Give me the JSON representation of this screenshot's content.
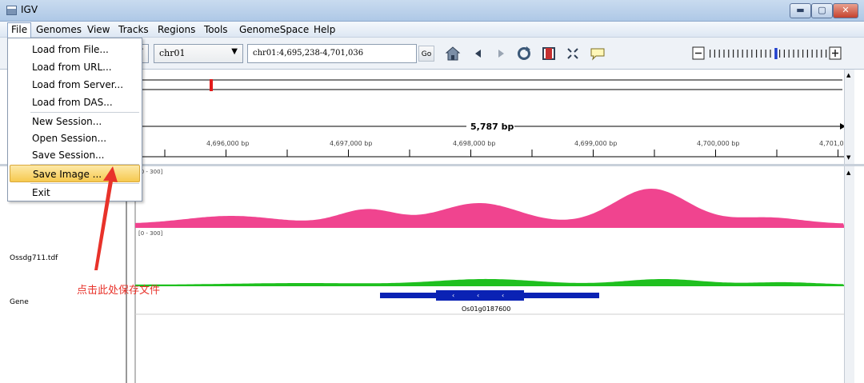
{
  "window": {
    "title": "IGV"
  },
  "menubar": [
    "File",
    "Genomes",
    "View",
    "Tracks",
    "Regions",
    "Tools",
    "GenomeSpace",
    "Help"
  ],
  "toolbar": {
    "chromosome": "chr01",
    "locus": "chr01:4,695,238-4,701,036",
    "go_label": "Go"
  },
  "ruler": {
    "span_label": "5,787 bp",
    "ticks": [
      "4,696,000 bp",
      "4,697,000 bp",
      "4,698,000 bp",
      "4,699,000 bp",
      "4,700,000 bp",
      "4,701,0"
    ]
  },
  "tracks": {
    "track1": {
      "range": "[0 - 300]"
    },
    "track2": {
      "name": "Ossdg711.tdf",
      "range": "[0 - 300]"
    },
    "gene": {
      "name": "Gene",
      "feature": "Os01g0187600"
    }
  },
  "file_menu": {
    "items": [
      "Load from File...",
      "Load from URL...",
      "Load from Server...",
      "Load from DAS...",
      "New Session...",
      "Open Session...",
      "Save Session...",
      "Save Image ...",
      "Exit"
    ],
    "highlighted_index": 7
  },
  "annotation": {
    "text": "点击此处保存文件"
  },
  "colors": {
    "coverage1": "#f0448f",
    "coverage2": "#1fc01f",
    "gene": "#0a22b4",
    "annotation": "#e8322a"
  }
}
